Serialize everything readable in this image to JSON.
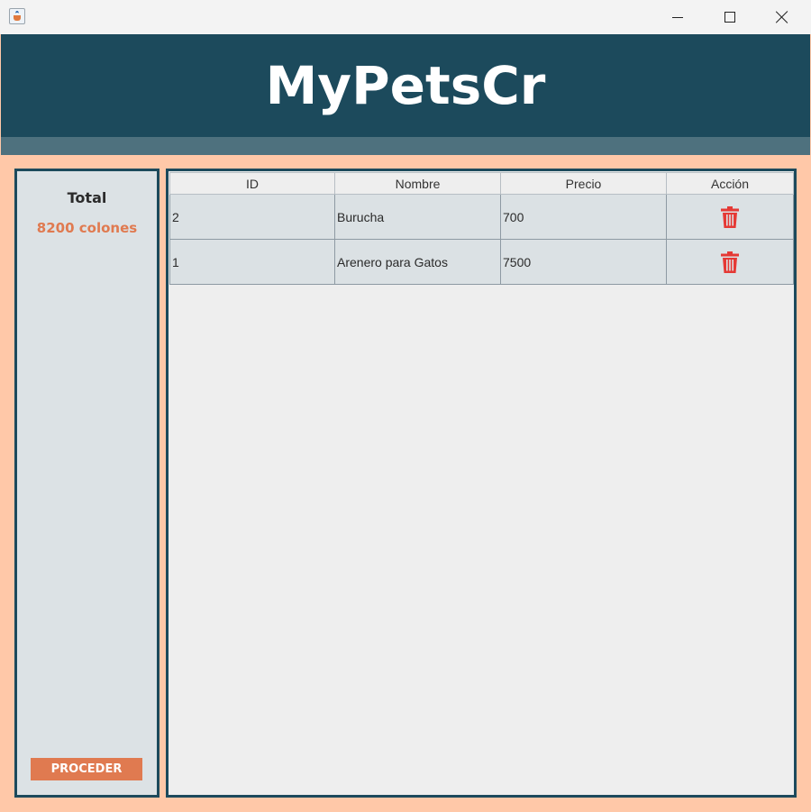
{
  "window": {
    "icon": "java-cup-icon",
    "controls": [
      "minimize-icon",
      "maximize-icon",
      "close-icon"
    ]
  },
  "header": {
    "title": "MyPetsCr"
  },
  "summary": {
    "total_label": "Total",
    "total_value": "8200 colones",
    "proceed_label": "PROCEDER"
  },
  "table": {
    "columns": [
      "ID",
      "Nombre",
      "Precio",
      "Acción"
    ],
    "rows": [
      {
        "id": "2",
        "nombre": "Burucha",
        "precio": "700",
        "accion_icon": "trash-icon"
      },
      {
        "id": "1",
        "nombre": "Arenero para Gatos",
        "precio": "7500",
        "accion_icon": "trash-icon"
      }
    ]
  },
  "colors": {
    "header_bg": "#1c4a5c",
    "subbar_bg": "#4e717e",
    "window_bg": "#ffc8a8",
    "accent": "#e07a50",
    "delete_red": "#e53935"
  }
}
